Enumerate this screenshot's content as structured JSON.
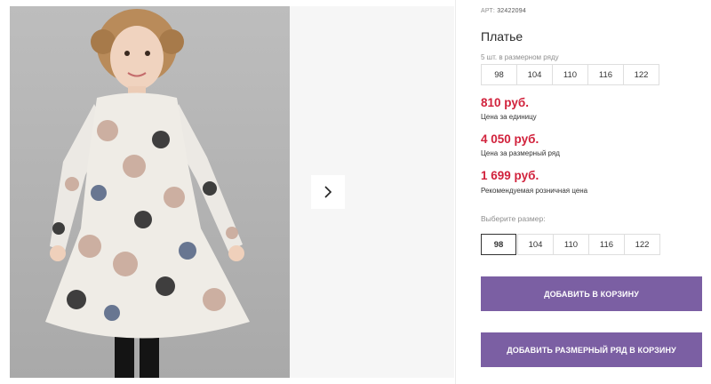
{
  "product": {
    "article_label": "АРТ:",
    "article_number": "32422094",
    "title": "Платье",
    "pack_note": "5 шт. в размерном ряду",
    "pack_sizes": [
      "98",
      "104",
      "110",
      "116",
      "122"
    ]
  },
  "prices": {
    "unit_price": "810 руб.",
    "unit_label": "Цена за единицу",
    "pack_price": "4 050 руб.",
    "pack_label": "Цена за размерный ряд",
    "retail_price": "1 699 руб.",
    "retail_label": "Рекомендуемая розничная цена"
  },
  "size_picker": {
    "label": "Выберите размер:",
    "options": [
      "98",
      "104",
      "110",
      "116",
      "122"
    ],
    "selected": "98"
  },
  "actions": {
    "add_to_cart": "ДОБАВИТЬ В КОРЗИНУ",
    "add_pack_to_cart": "ДОБАВИТЬ РАЗМЕРНЫЙ РЯД В КОРЗИНУ"
  },
  "gallery": {
    "next_icon": "chevron-right-icon"
  },
  "colors": {
    "price": "#d1223c",
    "button": "#7b5fa3"
  }
}
